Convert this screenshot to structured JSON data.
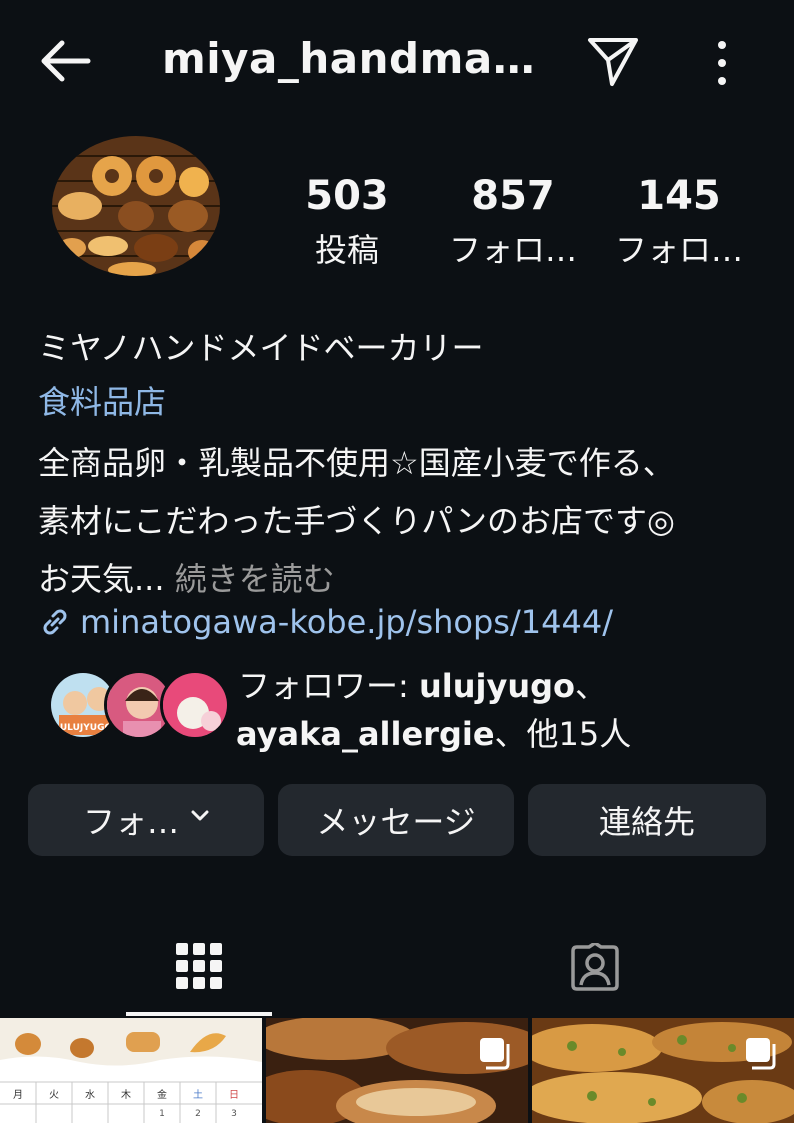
{
  "header": {
    "username": "miya_handma…"
  },
  "stats": [
    {
      "count": "503",
      "label": "投稿"
    },
    {
      "count": "857",
      "label": "フォロ…"
    },
    {
      "count": "145",
      "label": "フォロ…"
    }
  ],
  "profile": {
    "name": "ミヤノハンドメイドベーカリー",
    "category": "食料品店",
    "bio_line1": "全商品卵・乳製品不使用☆国産小麦で作る、",
    "bio_line2": "素材にこだわった手づくりパンのお店です◎",
    "bio_line3": "お天気...",
    "read_more": "続きを読む",
    "link": "minatogawa-kobe.jp/shops/1444/"
  },
  "followed_by": {
    "prefix": "フォロワー: ",
    "user1": "ulujyugo",
    "sep1": "、",
    "user2": "ayaka_allergie",
    "suffix": "、他15人",
    "mini_avatar_text": "ULUJYUGO"
  },
  "buttons": {
    "follow_label": "フォ…",
    "message_label": "メッセージ",
    "contact_label": "連絡先"
  },
  "calendar_days": [
    "月",
    "火",
    "水",
    "木",
    "金",
    "土",
    "日"
  ],
  "calendar_dates": [
    "1",
    "2",
    "3"
  ],
  "colors": {
    "background": "#0c1014",
    "button": "#23282e",
    "category": "#8fb8e6",
    "link": "#9fc3ec"
  },
  "icons": {
    "back": "arrow-left-icon",
    "send": "paper-plane-icon",
    "more": "vertical-dots-icon",
    "grid": "grid-icon",
    "tagged": "tagged-person-icon",
    "link": "link-icon",
    "multi": "multiple-photos-icon"
  }
}
